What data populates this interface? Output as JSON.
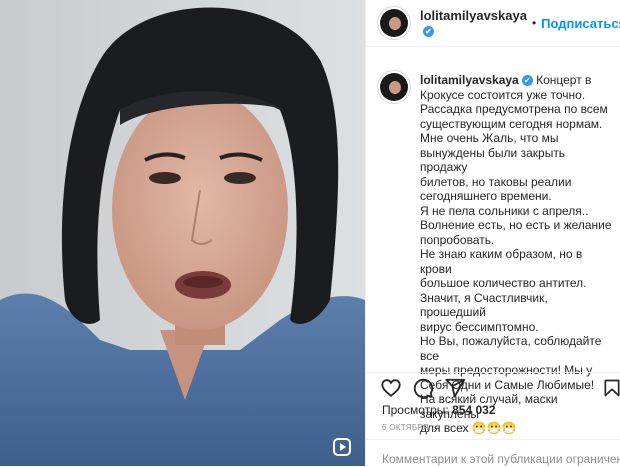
{
  "post": {
    "username": "lolitamilyavskaya",
    "verified_mark": "✔",
    "separator": "•",
    "follow_label": "Подписаться",
    "caption_lines": [
      "Концерт в",
      "Крокусе состоится уже точно.",
      "Рассадка предусмотрена по всем",
      "существующим сегодня нормам.",
      "Мне очень Жаль, что мы",
      "вынуждены были закрыть продажу",
      "билетов, но таковы реалии",
      "сегодняшнего времени.",
      "Я не пела сольники с апреля..",
      "Волнение есть, но есть и желание",
      "попробовать.",
      "Не знаю каким образом, но в крови",
      "большое количество антител.",
      "Значит, я Счастливчик, прошедший",
      "вирус бессимптомно.",
      "Но Вы, пожалуйста, соблюдайте все",
      "меры предосторожности! Мы у",
      "Себя Одни и Самые Любимые!",
      "На всякий случай, маски закуплены",
      "для всех 😷😷😷"
    ],
    "views_label": "Просмотры:",
    "views_count": "854 032",
    "date": "6 ОКТЯБРЯ",
    "comments_notice": "Комментарии к этой публикации ограничены"
  },
  "icons": {
    "like": "heart-icon",
    "comment": "comment-icon",
    "share": "share-icon",
    "save": "bookmark-icon",
    "video": "reel-icon"
  },
  "colors": {
    "accent": "#0095f6",
    "verified": "#3897f0",
    "muted": "#8e8e8e",
    "text": "#262626"
  }
}
